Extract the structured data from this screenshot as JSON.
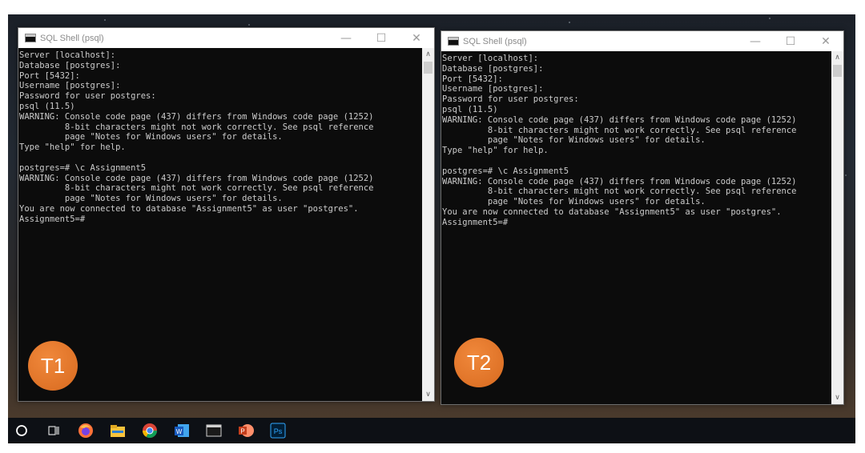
{
  "windows": [
    {
      "title": "SQL Shell (psql)",
      "badge": "T1",
      "lines": [
        "Server [localhost]:",
        "Database [postgres]:",
        "Port [5432]:",
        "Username [postgres]:",
        "Password for user postgres:",
        "psql (11.5)",
        "WARNING: Console code page (437) differs from Windows code page (1252)",
        "         8-bit characters might not work correctly. See psql reference",
        "         page \"Notes for Windows users\" for details.",
        "Type \"help\" for help.",
        "",
        "postgres=# \\c Assignment5",
        "WARNING: Console code page (437) differs from Windows code page (1252)",
        "         8-bit characters might not work correctly. See psql reference",
        "         page \"Notes for Windows users\" for details.",
        "You are now connected to database \"Assignment5\" as user \"postgres\".",
        "Assignment5=#"
      ]
    },
    {
      "title": "SQL Shell (psql)",
      "badge": "T2",
      "lines": [
        "Server [localhost]:",
        "Database [postgres]:",
        "Port [5432]:",
        "Username [postgres]:",
        "Password for user postgres:",
        "psql (11.5)",
        "WARNING: Console code page (437) differs from Windows code page (1252)",
        "         8-bit characters might not work correctly. See psql reference",
        "         page \"Notes for Windows users\" for details.",
        "Type \"help\" for help.",
        "",
        "postgres=# \\c Assignment5",
        "WARNING: Console code page (437) differs from Windows code page (1252)",
        "         8-bit characters might not work correctly. See psql reference",
        "         page \"Notes for Windows users\" for details.",
        "You are now connected to database \"Assignment5\" as user \"postgres\".",
        "Assignment5=#"
      ]
    }
  ],
  "window_controls": {
    "minimize": "—",
    "maximize": "☐",
    "close": "✕"
  },
  "taskbar": {
    "items": [
      {
        "name": "cortana-search-icon"
      },
      {
        "name": "task-view-icon"
      },
      {
        "name": "firefox-icon"
      },
      {
        "name": "file-explorer-icon"
      },
      {
        "name": "chrome-icon"
      },
      {
        "name": "word-icon",
        "label": "W"
      },
      {
        "name": "terminal-icon"
      },
      {
        "name": "powerpoint-icon",
        "label": "P"
      },
      {
        "name": "photoshop-icon",
        "label": "Ps"
      }
    ]
  },
  "colors": {
    "console_bg": "#0c0c0c",
    "console_text": "#cccccc",
    "badge": "#e5782c",
    "taskbar": "#0d1015"
  }
}
